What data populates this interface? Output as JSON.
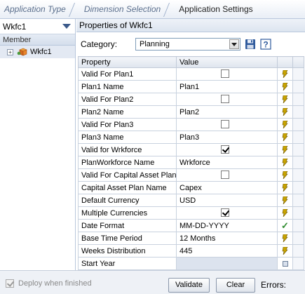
{
  "breadcrumb": {
    "steps": [
      "Application Type",
      "Dimension Selection",
      "Application Settings"
    ]
  },
  "left_pane": {
    "selected_dimension": "Wkfc1",
    "member_header": "Member",
    "tree_root": "Wkfc1",
    "expander_symbol": "+"
  },
  "properties": {
    "title": "Properties of Wkfc1",
    "category_label": "Category:",
    "category_value": "Planning",
    "save_icon": "save-icon",
    "help_icon": "help-icon",
    "help_symbol": "?",
    "columns": {
      "property": "Property",
      "value": "Value"
    },
    "rows": [
      {
        "property": "Valid For Plan1",
        "type": "checkbox",
        "checked": false,
        "status": "pending"
      },
      {
        "property": "Plan1 Name",
        "type": "text",
        "value": "Plan1",
        "status": "pending"
      },
      {
        "property": "Valid For Plan2",
        "type": "checkbox",
        "checked": false,
        "status": "pending"
      },
      {
        "property": "Plan2 Name",
        "type": "text",
        "value": "Plan2",
        "status": "pending"
      },
      {
        "property": "Valid For Plan3",
        "type": "checkbox",
        "checked": false,
        "status": "pending"
      },
      {
        "property": "Plan3 Name",
        "type": "text",
        "value": "Plan3",
        "status": "pending"
      },
      {
        "property": "Valid for Wrkforce",
        "type": "checkbox",
        "checked": true,
        "status": "pending"
      },
      {
        "property": "PlanWorkforce Name",
        "type": "text",
        "value": "Wrkforce",
        "status": "pending"
      },
      {
        "property": "Valid For Capital Asset Plan",
        "type": "checkbox",
        "checked": false,
        "status": "pending"
      },
      {
        "property": "Capital Asset Plan Name",
        "type": "text",
        "value": "Capex",
        "status": "pending"
      },
      {
        "property": "Default Currency",
        "type": "text",
        "value": "USD",
        "status": "pending"
      },
      {
        "property": "Multiple Currencies",
        "type": "checkbox",
        "checked": true,
        "status": "pending"
      },
      {
        "property": "Date Format",
        "type": "text",
        "value": "MM-DD-YYYY",
        "status": "ok"
      },
      {
        "property": "Base Time Period",
        "type": "text",
        "value": "12 Months",
        "status": "pending"
      },
      {
        "property": "Weeks Distribution",
        "type": "text",
        "value": "445",
        "status": "pending"
      },
      {
        "property": "Start Year",
        "type": "text",
        "value": "",
        "status": "db"
      }
    ]
  },
  "footer": {
    "deploy_label": "Deploy when finished",
    "deploy_checked": true,
    "validate_label": "Validate",
    "clear_label": "Clear",
    "errors_label": "Errors:"
  },
  "colors": {
    "accent": "#3b5a8a",
    "header_bg": "#dde5f0",
    "ok_green": "#2e8b2e"
  }
}
